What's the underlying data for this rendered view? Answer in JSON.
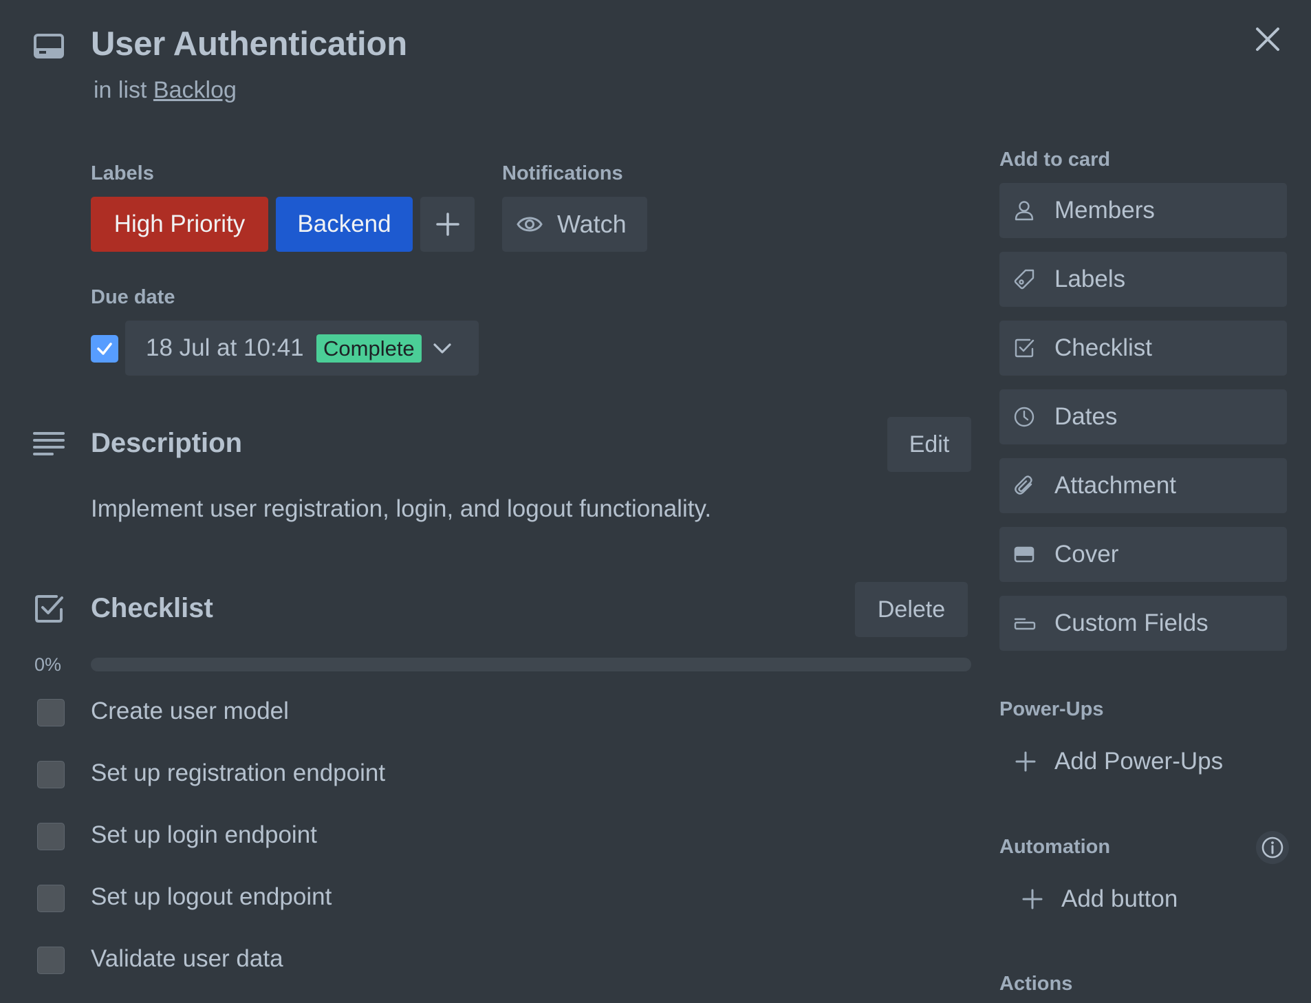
{
  "card": {
    "title": "User Authentication",
    "list_prefix": "in list ",
    "list_name": "Backlog"
  },
  "labels": {
    "heading": "Labels",
    "items": [
      {
        "name": "High Priority",
        "color": "#ae2e24"
      },
      {
        "name": "Backend",
        "color": "#1d5ad0"
      }
    ]
  },
  "notifications": {
    "heading": "Notifications",
    "watch_label": "Watch"
  },
  "due_date": {
    "heading": "Due date",
    "value": "18 Jul at 10:41",
    "status": "Complete",
    "checked": true
  },
  "description": {
    "heading": "Description",
    "edit_label": "Edit",
    "text": "Implement user registration, login, and logout functionality."
  },
  "checklist": {
    "heading": "Checklist",
    "delete_label": "Delete",
    "progress_text": "0%",
    "progress": 0,
    "items": [
      {
        "text": "Create user model",
        "checked": false
      },
      {
        "text": "Set up registration endpoint",
        "checked": false
      },
      {
        "text": "Set up login endpoint",
        "checked": false
      },
      {
        "text": "Set up logout endpoint",
        "checked": false
      },
      {
        "text": "Validate user data",
        "checked": false
      }
    ]
  },
  "sidebar": {
    "add_to_card_heading": "Add to card",
    "buttons": [
      {
        "label": "Members",
        "icon": "person-icon"
      },
      {
        "label": "Labels",
        "icon": "tag-icon"
      },
      {
        "label": "Checklist",
        "icon": "checkbox-icon"
      },
      {
        "label": "Dates",
        "icon": "clock-icon"
      },
      {
        "label": "Attachment",
        "icon": "paperclip-icon"
      },
      {
        "label": "Cover",
        "icon": "cover-icon"
      },
      {
        "label": "Custom Fields",
        "icon": "custom-fields-icon"
      }
    ],
    "powerups_heading": "Power-Ups",
    "add_powerups_label": "Add Power-Ups",
    "automation_heading": "Automation",
    "add_button_label": "Add button",
    "actions_heading": "Actions"
  },
  "colors": {
    "background": "#323940",
    "button": "#3b434c",
    "complete_badge": "#4bce97",
    "checkbox_checked": "#579dff"
  }
}
